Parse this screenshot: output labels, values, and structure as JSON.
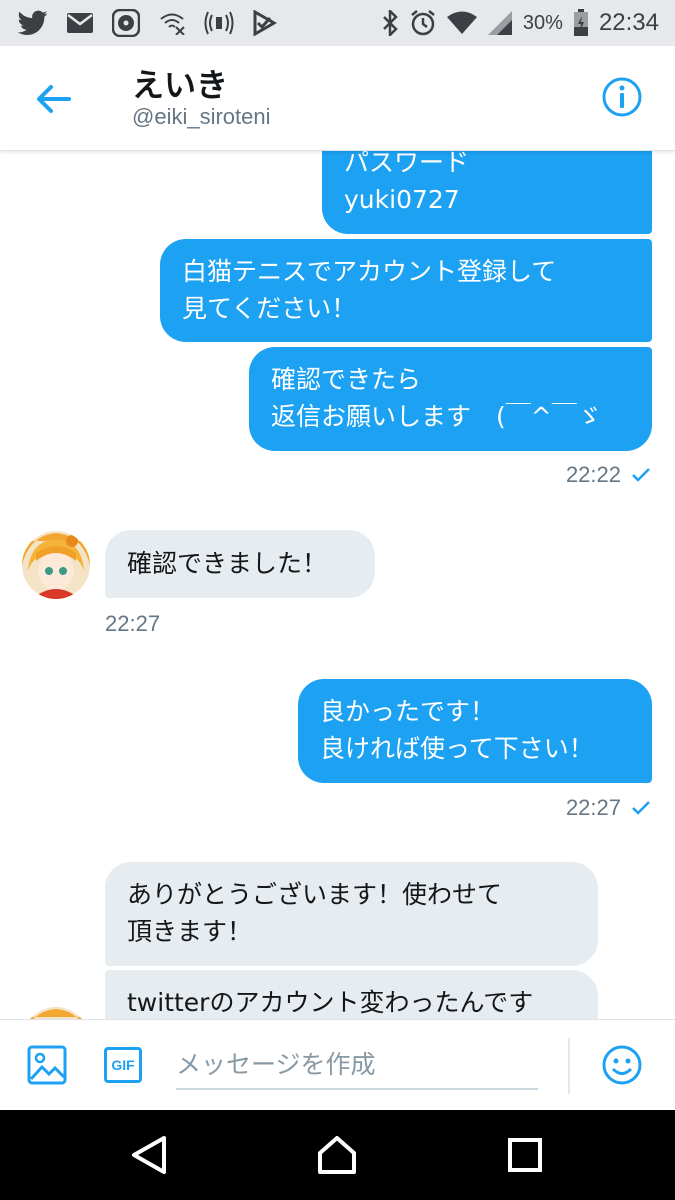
{
  "status_bar": {
    "battery": "30%",
    "time": "22:34",
    "left_icons": [
      "twitter-icon",
      "mail-icon",
      "music-icon",
      "wifi-off-icon",
      "broadcast-icon",
      "task-icon"
    ],
    "right_icons": [
      "bluetooth-icon",
      "alarm-icon",
      "wifi-icon",
      "signal-icon",
      "battery-icon"
    ]
  },
  "header": {
    "title": "えいき",
    "handle": "@eiki_siroteni"
  },
  "messages": [
    {
      "dir": "out",
      "text": "パスワード\nyuki0727"
    },
    {
      "dir": "out",
      "text": "白猫テニスでアカウント登録して\n見てください！"
    },
    {
      "dir": "out",
      "text": "確認できたら\n返信お願いします　(￣^￣ゞ"
    },
    {
      "meta": "22:22",
      "read": true
    },
    {
      "dir": "in",
      "text": "確認できました！"
    },
    {
      "meta": "22:27"
    },
    {
      "dir": "out",
      "text": "良かったです！\n良ければ使って下さい！"
    },
    {
      "meta": "22:27",
      "read": true
    },
    {
      "dir": "in",
      "text": "ありがとうございます！使わせて\n頂きます！"
    },
    {
      "dir": "in",
      "text": "twitterのアカウント変わったんです"
    }
  ],
  "composer": {
    "placeholder": "メッセージを作成",
    "gif_label": "GIF"
  },
  "colors": {
    "accent": "#1da1f2",
    "incoming_bubble": "#e6ecf0",
    "muted_text": "#657786"
  }
}
